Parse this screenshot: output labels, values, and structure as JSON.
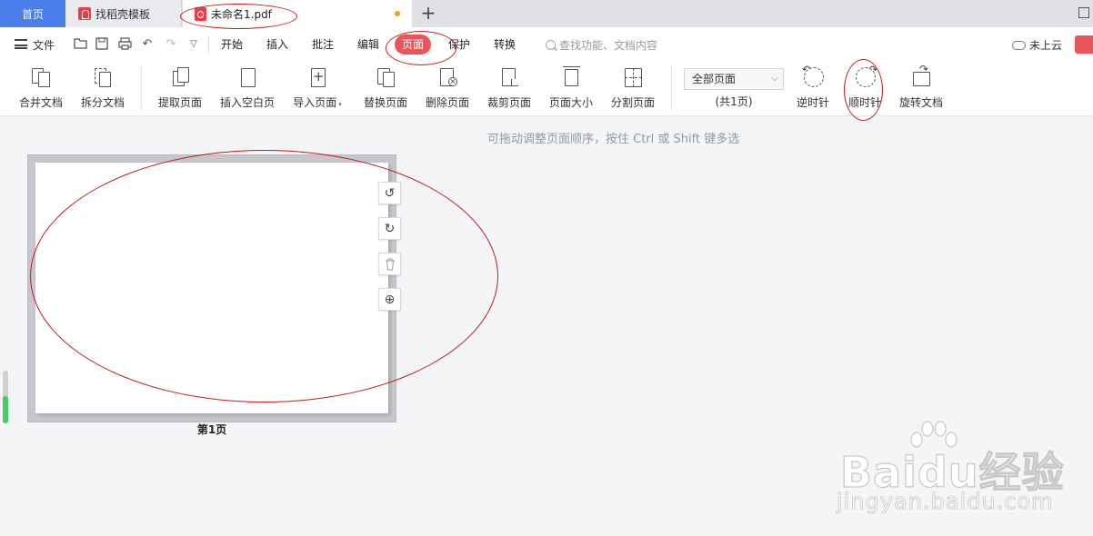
{
  "tabs": {
    "home": "首页",
    "templates": "找稻壳模板",
    "document": "未命名1.pdf"
  },
  "menu": {
    "file": "文件",
    "tabs": [
      "开始",
      "插入",
      "批注",
      "编辑",
      "页面",
      "保护",
      "转换"
    ],
    "active_tab": "页面",
    "search_placeholder": "查找功能、文档内容",
    "cloud": "未上云"
  },
  "ribbon": {
    "merge": "合并文档",
    "split": "拆分文档",
    "extract": "提取页面",
    "insert_blank": "插入空白页",
    "import": "导入页面",
    "replace": "替换页面",
    "delete": "删除页面",
    "crop": "裁剪页面",
    "page_size": "页面大小",
    "split_page": "分割页面",
    "page_range": "全部页面",
    "page_count": "(共1页)",
    "ccw": "逆时针",
    "cw": "顺时针",
    "rotate_doc": "旋转文档"
  },
  "content": {
    "hint": "可拖动调整页面顺序，按住 Ctrl 或 Shift 键多选",
    "page_label": "第1页"
  },
  "watermark": {
    "brand": "Bai",
    "brand2": "du",
    "cn": "经验",
    "url": "jingyan.baidu.com"
  },
  "colors": {
    "accent": "#e8565b",
    "home_tab": "#4a7ee8",
    "annotation": "#c51b1b"
  }
}
